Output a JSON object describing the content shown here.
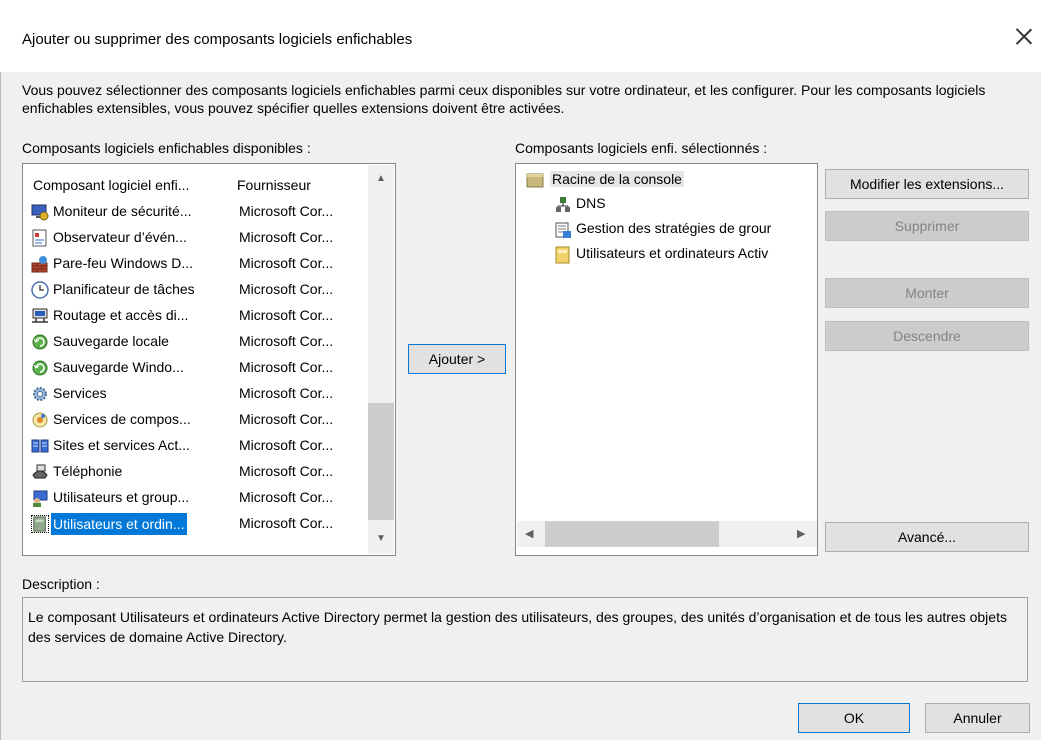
{
  "dialog": {
    "title": "Ajouter ou supprimer des composants logiciels enfichables",
    "intro": "Vous pouvez sélectionner des composants logiciels enfichables parmi ceux disponibles sur votre ordinateur, et les configurer. Pour les composants logiciels enfichables extensibles, vous pouvez spécifier quelles extensions doivent être activées."
  },
  "available": {
    "label": "Composants logiciels enfichables disponibles :",
    "col_name": "Composant logiciel enfi...",
    "col_provider": "Fournisseur",
    "items": [
      {
        "name": "Moniteur de sécurité...",
        "provider": "Microsoft Cor...",
        "icon": "security-monitor-icon"
      },
      {
        "name": "Observateur d’évén...",
        "provider": "Microsoft Cor...",
        "icon": "event-viewer-icon"
      },
      {
        "name": "Pare-feu Windows D...",
        "provider": "Microsoft Cor...",
        "icon": "firewall-icon"
      },
      {
        "name": "Planificateur de tâches",
        "provider": "Microsoft Cor...",
        "icon": "clock-icon"
      },
      {
        "name": "Routage et accès di...",
        "provider": "Microsoft Cor...",
        "icon": "routing-icon"
      },
      {
        "name": "Sauvegarde locale",
        "provider": "Microsoft Cor...",
        "icon": "backup-icon"
      },
      {
        "name": "Sauvegarde Windo...",
        "provider": "Microsoft Cor...",
        "icon": "backup-icon"
      },
      {
        "name": "Services",
        "provider": "Microsoft Cor...",
        "icon": "gear-icon"
      },
      {
        "name": "Services de compos...",
        "provider": "Microsoft Cor...",
        "icon": "component-services-icon"
      },
      {
        "name": "Sites et services Act...",
        "provider": "Microsoft Cor...",
        "icon": "sites-icon"
      },
      {
        "name": "Téléphonie",
        "provider": "Microsoft Cor...",
        "icon": "telephony-icon"
      },
      {
        "name": "Utilisateurs et group...",
        "provider": "Microsoft Cor...",
        "icon": "users-groups-icon"
      },
      {
        "name": "Utilisateurs et ordin...",
        "provider": "Microsoft Cor...",
        "icon": "ad-users-computers-icon",
        "selected": true
      }
    ]
  },
  "add_button": "Ajouter >",
  "selected": {
    "label": "Composants logiciels enfi. sélectionnés :",
    "root": "Racine de la console",
    "children": [
      "DNS",
      "Gestion des stratégies de grour",
      "Utilisateurs et ordinateurs Activ"
    ]
  },
  "buttons": {
    "modify": "Modifier les extensions...",
    "remove": "Supprimer",
    "up": "Monter",
    "down": "Descendre",
    "advanced": "Avancé...",
    "ok": "OK",
    "cancel": "Annuler"
  },
  "description": {
    "label": "Description :",
    "text": "Le composant Utilisateurs et ordinateurs Active Directory permet la gestion des utilisateurs, des groupes, des unités d’organisation et de tous les autres objets des services de domaine Active Directory."
  }
}
